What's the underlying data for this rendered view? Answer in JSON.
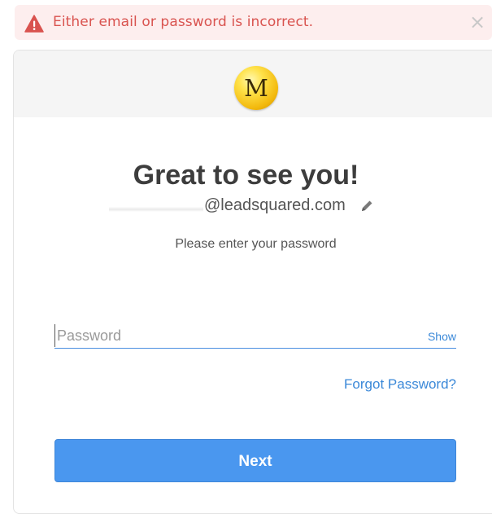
{
  "alert": {
    "icon": "warning-triangle-icon",
    "message": "Either email or password is incorrect.",
    "close_icon": "close-icon",
    "close_glyph": "×",
    "color": "#d9534f",
    "background": "#fdeeee"
  },
  "header": {
    "logo_icon": "app-logo",
    "logo_letter": "M"
  },
  "main": {
    "title": "Great to see you!",
    "email_visible": "@leadsquared.com",
    "edit_icon": "pencil-icon",
    "subtitle": "Please enter your password"
  },
  "password": {
    "placeholder": "Password",
    "value": "",
    "show_label": "Show"
  },
  "links": {
    "forgot_password": "Forgot Password?"
  },
  "actions": {
    "next_label": "Next",
    "accent_color": "#4a97ef"
  }
}
